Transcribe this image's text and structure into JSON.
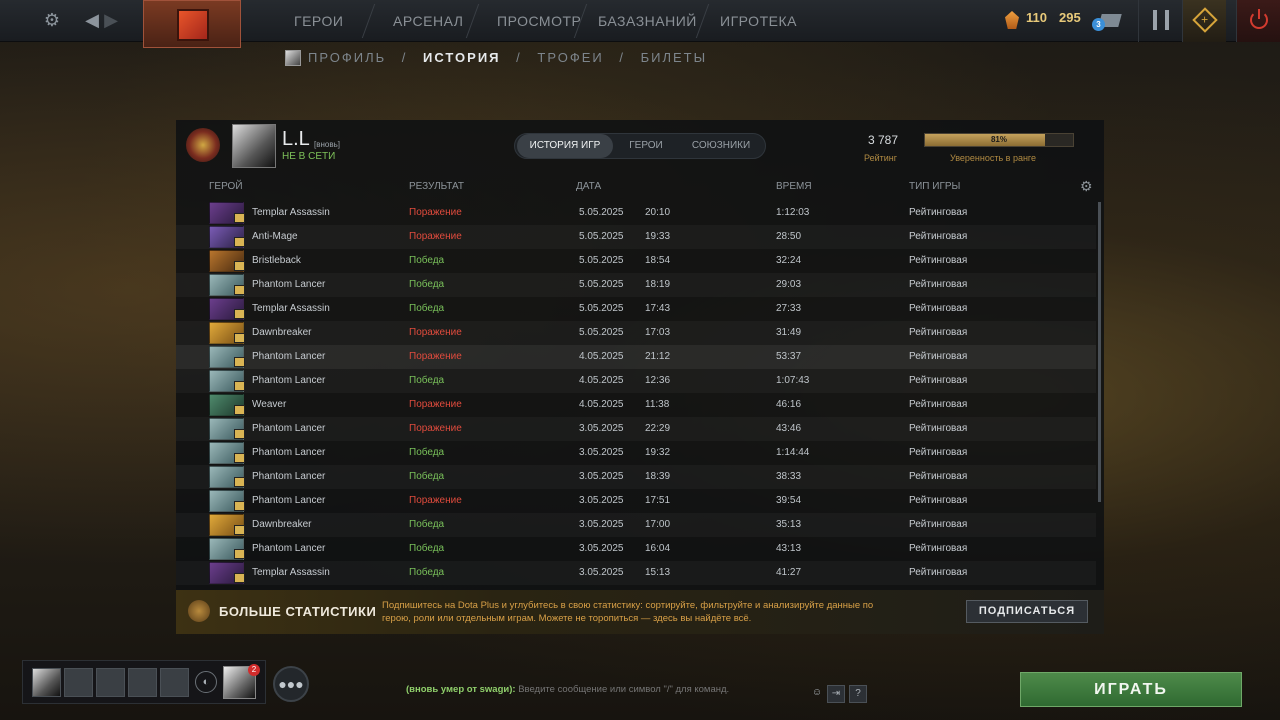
{
  "topbar": {
    "nav": [
      "ГЕРОИ",
      "АРСЕНАЛ",
      "ПРОСМОТР",
      "БАЗАЗНАНИЙ",
      "ИГРОТЕКА"
    ],
    "shards": "110",
    "gold": "295",
    "mail_count": "3"
  },
  "subnav": {
    "items": [
      "ПРОФИЛЬ",
      "ИСТОРИЯ",
      "ТРОФЕИ",
      "БИЛЕТЫ"
    ],
    "separator": "/",
    "active": "ИСТОРИЯ"
  },
  "profile": {
    "name": "L.L",
    "tag": "[вновь]",
    "status": "НЕ В СЕТИ",
    "rating_value": "3 787",
    "rating_label": "Рейтинг",
    "confidence_percent": "81%",
    "confidence_fraction": 0.81,
    "confidence_label": "Уверенность в ранге"
  },
  "tabs": [
    "ИСТОРИЯ ИГР",
    "ГЕРОИ",
    "СОЮЗНИКИ"
  ],
  "columns": {
    "hero": "ГЕРОЙ",
    "result": "РЕЗУЛЬТАТ",
    "date": "ДАТА",
    "duration": "ВРЕМЯ",
    "game_type": "ТИП ИГРЫ"
  },
  "matches": [
    {
      "hero": "Templar Assassin",
      "result": "Поражение",
      "outcome": "loss",
      "date": "5.05.2025",
      "time": "20:10",
      "duration": "1:12:03",
      "type": "Рейтинговая"
    },
    {
      "hero": "Anti-Mage",
      "result": "Поражение",
      "outcome": "loss",
      "date": "5.05.2025",
      "time": "19:33",
      "duration": "28:50",
      "type": "Рейтинговая"
    },
    {
      "hero": "Bristleback",
      "result": "Победа",
      "outcome": "win",
      "date": "5.05.2025",
      "time": "18:54",
      "duration": "32:24",
      "type": "Рейтинговая"
    },
    {
      "hero": "Phantom Lancer",
      "result": "Победа",
      "outcome": "win",
      "date": "5.05.2025",
      "time": "18:19",
      "duration": "29:03",
      "type": "Рейтинговая"
    },
    {
      "hero": "Templar Assassin",
      "result": "Победа",
      "outcome": "win",
      "date": "5.05.2025",
      "time": "17:43",
      "duration": "27:33",
      "type": "Рейтинговая"
    },
    {
      "hero": "Dawnbreaker",
      "result": "Поражение",
      "outcome": "loss",
      "date": "5.05.2025",
      "time": "17:03",
      "duration": "31:49",
      "type": "Рейтинговая"
    },
    {
      "hero": "Phantom Lancer",
      "result": "Поражение",
      "outcome": "loss",
      "date": "4.05.2025",
      "time": "21:12",
      "duration": "53:37",
      "type": "Рейтинговая"
    },
    {
      "hero": "Phantom Lancer",
      "result": "Победа",
      "outcome": "win",
      "date": "4.05.2025",
      "time": "12:36",
      "duration": "1:07:43",
      "type": "Рейтинговая"
    },
    {
      "hero": "Weaver",
      "result": "Поражение",
      "outcome": "loss",
      "date": "4.05.2025",
      "time": "11:38",
      "duration": "46:16",
      "type": "Рейтинговая"
    },
    {
      "hero": "Phantom Lancer",
      "result": "Поражение",
      "outcome": "loss",
      "date": "3.05.2025",
      "time": "22:29",
      "duration": "43:46",
      "type": "Рейтинговая"
    },
    {
      "hero": "Phantom Lancer",
      "result": "Победа",
      "outcome": "win",
      "date": "3.05.2025",
      "time": "19:32",
      "duration": "1:14:44",
      "type": "Рейтинговая"
    },
    {
      "hero": "Phantom Lancer",
      "result": "Победа",
      "outcome": "win",
      "date": "3.05.2025",
      "time": "18:39",
      "duration": "38:33",
      "type": "Рейтинговая"
    },
    {
      "hero": "Phantom Lancer",
      "result": "Поражение",
      "outcome": "loss",
      "date": "3.05.2025",
      "time": "17:51",
      "duration": "39:54",
      "type": "Рейтинговая"
    },
    {
      "hero": "Dawnbreaker",
      "result": "Победа",
      "outcome": "win",
      "date": "3.05.2025",
      "time": "17:00",
      "duration": "35:13",
      "type": "Рейтинговая"
    },
    {
      "hero": "Phantom Lancer",
      "result": "Победа",
      "outcome": "win",
      "date": "3.05.2025",
      "time": "16:04",
      "duration": "43:13",
      "type": "Рейтинговая"
    },
    {
      "hero": "Templar Assassin",
      "result": "Победа",
      "outcome": "win",
      "date": "3.05.2025",
      "time": "15:13",
      "duration": "41:27",
      "type": "Рейтинговая"
    }
  ],
  "promo": {
    "title": "БОЛЬШЕ СТАТИСТИКИ",
    "text": "Подпишитесь на Dota Plus и углубитесь в свою статистику: сортируйте, фильтруйте и анализируйте данные по герою, роли или отдельным играм. Можете не торопиться — здесь вы найдёте всё.",
    "button": "ПОДПИСАТЬСЯ"
  },
  "party": {
    "friend_badge": "2"
  },
  "chat": {
    "channel": "(вновь умер от swagи):",
    "placeholder": "Введите сообщение или символ \"/\" для команд."
  },
  "help_label": "?",
  "play_button": "ИГРАТЬ",
  "colors": {
    "win": "#79c05a",
    "loss": "#e04b3d",
    "accent_gold": "#b08a42",
    "play_green": "#3d7a3c"
  },
  "icons": [
    "settings-icon",
    "back-icon",
    "forward-icon",
    "dota-logo-icon",
    "shard-icon",
    "mail-icon",
    "armory-icon",
    "plus-icon",
    "power-icon",
    "gear-icon",
    "voice-icon",
    "group-icon",
    "emoji-icon",
    "hotkey-icon",
    "help-icon"
  ]
}
